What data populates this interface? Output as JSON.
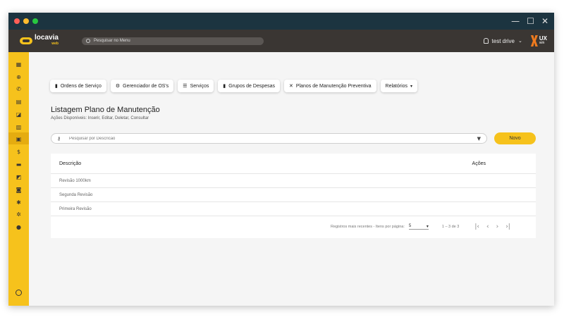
{
  "app": {
    "logo_text": "locavia",
    "logo_sub": "web",
    "menu_search_placeholder": "Pesquisar no Menu",
    "user_label": "test drive",
    "brand_ux": "UX",
    "brand_win": "win"
  },
  "window_controls": [
    "—",
    "☐",
    "✕"
  ],
  "sidebar": {
    "icons": [
      "report-icon",
      "add-circle-icon",
      "phone-icon",
      "document-icon",
      "car-icon",
      "clipboard-icon",
      "reports-icon",
      "money-icon",
      "truck-icon",
      "car-wash-icon",
      "car-front-icon",
      "settings-icon",
      "asterisk-icon",
      "info-icon",
      "whatsapp-icon"
    ],
    "active_index": 6
  },
  "tabs": [
    {
      "label": "Ordens de Serviço",
      "icon": "document-icon"
    },
    {
      "label": "Gerenciador de OS's",
      "icon": "gear-icon"
    },
    {
      "label": "Serviços",
      "icon": "list-icon"
    },
    {
      "label": "Grupos de Despesas",
      "icon": "file-money-icon"
    },
    {
      "label": "Planos de Manutenção Preventiva",
      "icon": "tools-icon"
    },
    {
      "label": "Relatórios",
      "icon": "chevron-down-icon"
    }
  ],
  "page": {
    "title": "Listagem Plano de Manutenção",
    "subtitle": "Ações Disponíveis: Inserir, Editar, Deletar, Consultar"
  },
  "search": {
    "placeholder": "Pesquisar por Descricao"
  },
  "novo_label": "Novo",
  "table": {
    "headers": [
      "Descrição",
      "Ações"
    ],
    "rows": [
      "Revisão 1000km",
      "Segunda Revisão",
      "Primeira Revisão"
    ]
  },
  "footer": {
    "label": "Registros mais recentes - Itens por página:",
    "page_size": "5",
    "range": "1 – 3 de 3",
    "pager": [
      "|‹",
      "‹",
      "›",
      "›|"
    ]
  }
}
